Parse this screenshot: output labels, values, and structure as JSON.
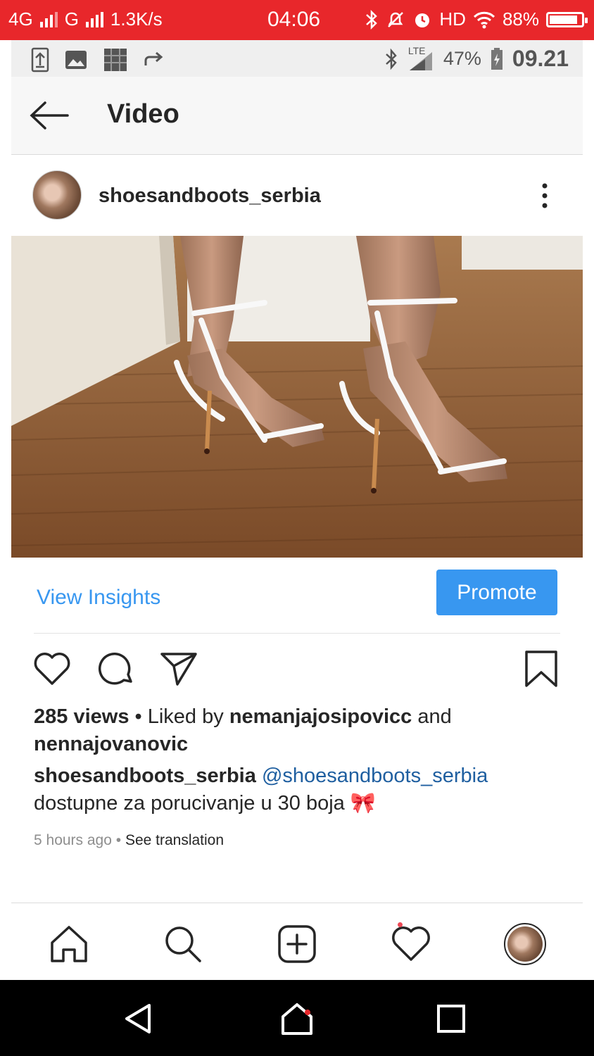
{
  "outer_status": {
    "network1": "4G",
    "network2": "G",
    "speed": "1.3K/s",
    "time": "04:06",
    "hd": "HD",
    "battery": "88%",
    "battery_level": 0.88
  },
  "inner_status": {
    "lte": "LTE",
    "battery": "47%",
    "clock": "09.21"
  },
  "header": {
    "title": "Video"
  },
  "post": {
    "username": "shoesandboots_serbia",
    "view_insights": "View Insights",
    "promote": "Promote",
    "views": "285 views",
    "liked_by_prefix": "Liked by",
    "liker1": "nemanjajosipovicc",
    "and": "and",
    "liker2": "nennajovanovic",
    "caption_user": "shoesandboots_serbia",
    "caption_mention": "@shoesandboots_serbia",
    "caption_text": "dostupne za porucivanje u 30 boja",
    "caption_emoji": "🎀",
    "time_ago": "5 hours ago",
    "see_translation": "See translation"
  },
  "icons": {
    "back": "arrow-left-icon",
    "more": "more-vertical-icon",
    "like": "heart-icon",
    "comment": "comment-icon",
    "share": "send-icon",
    "save": "bookmark-icon",
    "home": "home-icon",
    "search": "search-icon",
    "add": "add-post-icon",
    "activity": "heart-icon",
    "profile": "profile-avatar"
  },
  "colors": {
    "status_red": "#e8272b",
    "accent_blue": "#3897f0",
    "notification_dot": "#ed4956"
  }
}
